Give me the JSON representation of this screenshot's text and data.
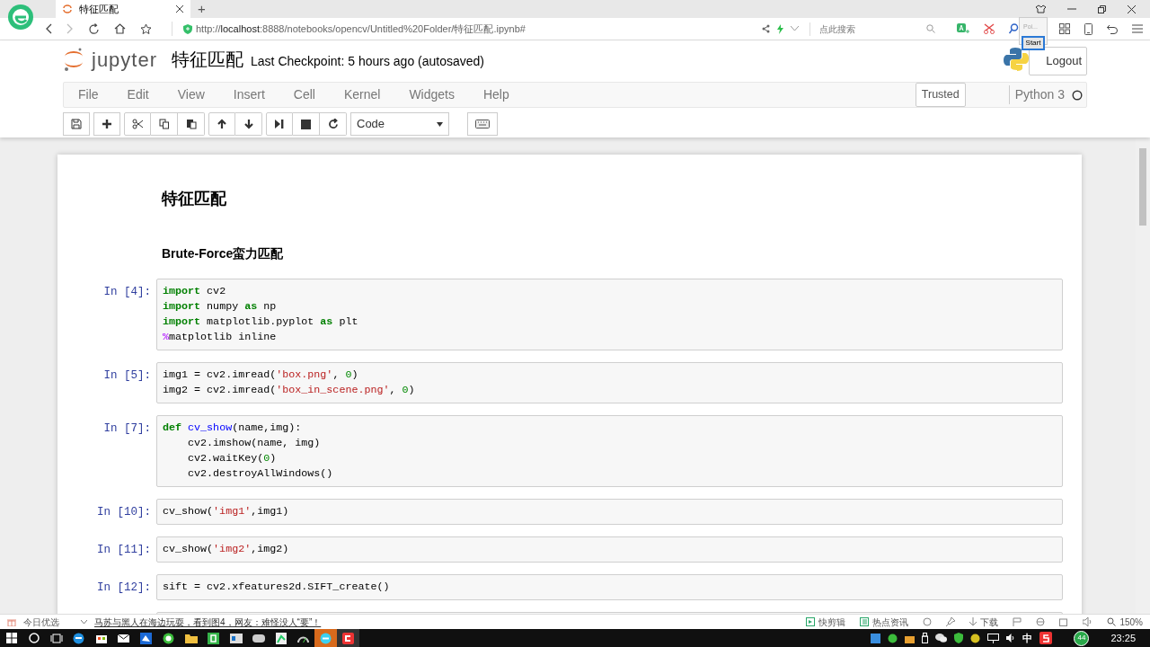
{
  "browser": {
    "tab_title": "特征匹配",
    "new_tab": "+",
    "url": {
      "scheme": "http://",
      "host": "localhost",
      "rest": ":8888/notebooks/opencv/Untitled%20Folder/特征匹配.ipynb#"
    },
    "search": {
      "placeholder": "点此搜索"
    },
    "popup": {
      "text": "Poi...",
      "button": "Start"
    }
  },
  "notebook": {
    "logo_text": "jupyter",
    "title": "特征匹配",
    "checkpoint": "Last Checkpoint: 5 hours ago (autosaved)",
    "logout": "Logout",
    "menu": [
      "File",
      "Edit",
      "View",
      "Insert",
      "Cell",
      "Kernel",
      "Widgets",
      "Help"
    ],
    "trusted": "Trusted",
    "kernel": "Python 3",
    "kernel_busy": false,
    "cell_type": "Code"
  },
  "cells": [
    {
      "kind": "heading1",
      "text": "特征匹配"
    },
    {
      "kind": "heading3",
      "text": "Brute-Force蛮力匹配"
    },
    {
      "kind": "code",
      "prompt": "In [4]:",
      "lines": [
        [
          {
            "kind": "keyword",
            "text": "import"
          },
          {
            "kind": "plain",
            "text": " cv2"
          }
        ],
        [
          {
            "kind": "keyword",
            "text": "import"
          },
          {
            "kind": "plain",
            "text": " numpy "
          },
          {
            "kind": "keyword",
            "text": "as"
          },
          {
            "kind": "plain",
            "text": " np"
          }
        ],
        [
          {
            "kind": "keyword",
            "text": "import"
          },
          {
            "kind": "plain",
            "text": " matplotlib.pyplot "
          },
          {
            "kind": "keyword",
            "text": "as"
          },
          {
            "kind": "plain",
            "text": " plt"
          }
        ],
        [
          {
            "kind": "magic",
            "text": "%"
          },
          {
            "kind": "plain",
            "text": "matplotlib inline"
          }
        ]
      ]
    },
    {
      "kind": "code",
      "prompt": "In [5]:",
      "lines": [
        [
          {
            "kind": "plain",
            "text": "img1 = cv2.imread("
          },
          {
            "kind": "string",
            "text": "'box.png'"
          },
          {
            "kind": "plain",
            "text": ", "
          },
          {
            "kind": "number",
            "text": "0"
          },
          {
            "kind": "plain",
            "text": ")"
          }
        ],
        [
          {
            "kind": "plain",
            "text": "img2 = cv2.imread("
          },
          {
            "kind": "string",
            "text": "'box_in_scene.png'"
          },
          {
            "kind": "plain",
            "text": ", "
          },
          {
            "kind": "number",
            "text": "0"
          },
          {
            "kind": "plain",
            "text": ")"
          }
        ]
      ]
    },
    {
      "kind": "code",
      "prompt": "In [7]:",
      "lines": [
        [
          {
            "kind": "keyword",
            "text": "def"
          },
          {
            "kind": "function",
            "text": " cv_show"
          },
          {
            "kind": "plain",
            "text": "(name,img):"
          }
        ],
        [
          {
            "kind": "plain",
            "text": "    cv2.imshow(name, img)"
          }
        ],
        [
          {
            "kind": "plain",
            "text": "    cv2.waitKey("
          },
          {
            "kind": "number",
            "text": "0"
          },
          {
            "kind": "plain",
            "text": ")"
          }
        ],
        [
          {
            "kind": "plain",
            "text": "    cv2.destroyAllWindows()"
          }
        ]
      ]
    },
    {
      "kind": "code",
      "prompt": "In [10]:",
      "lines": [
        [
          {
            "kind": "plain",
            "text": "cv_show("
          },
          {
            "kind": "string",
            "text": "'img1'"
          },
          {
            "kind": "plain",
            "text": ",img1)"
          }
        ]
      ]
    },
    {
      "kind": "code",
      "prompt": "In [11]:",
      "lines": [
        [
          {
            "kind": "plain",
            "text": "cv_show("
          },
          {
            "kind": "string",
            "text": "'img2'"
          },
          {
            "kind": "plain",
            "text": ",img2)"
          }
        ]
      ]
    },
    {
      "kind": "code",
      "prompt": "In [12]:",
      "lines": [
        [
          {
            "kind": "plain",
            "text": "sift = cv2.xfeatures2d.SIFT_create()"
          }
        ]
      ]
    },
    {
      "kind": "partial"
    }
  ],
  "status_bar": {
    "today": "今日优选",
    "news": "马苏与黑人在海边玩耍，看到图4，网友：难怪没人“要”！",
    "clip": "快剪辑",
    "hot": "热点资讯",
    "download": "下载",
    "zoom": "150%"
  },
  "taskbar": {
    "ime": "中",
    "badge": "44",
    "time": "23:25"
  }
}
